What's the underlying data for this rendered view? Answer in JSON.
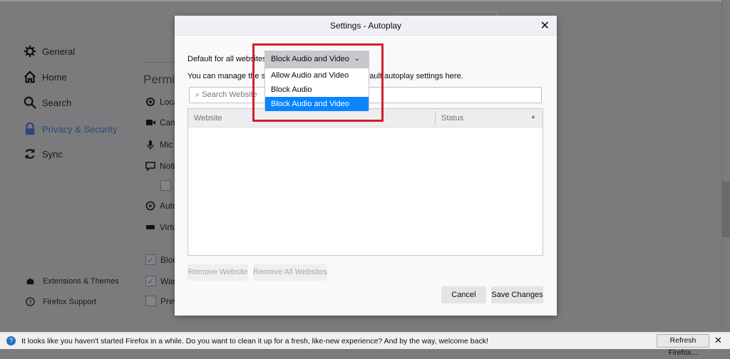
{
  "sidebar": {
    "items": [
      {
        "label": "General",
        "icon": "gear-icon"
      },
      {
        "label": "Home",
        "icon": "home-icon"
      },
      {
        "label": "Search",
        "icon": "search-icon"
      },
      {
        "label": "Privacy & Security",
        "icon": "lock-icon"
      },
      {
        "label": "Sync",
        "icon": "sync-icon"
      }
    ],
    "footer": [
      {
        "label": "Extensions & Themes",
        "icon": "puzzle-icon"
      },
      {
        "label": "Firefox Support",
        "icon": "help-icon"
      }
    ]
  },
  "background": {
    "section_title": "Permis",
    "items": [
      "Loca",
      "Cam",
      "Mic",
      "Noti",
      "Auto",
      "Virtu"
    ],
    "checks": [
      "Bloc",
      "War",
      "Prev"
    ]
  },
  "dialog": {
    "title": "Settings - Autoplay",
    "default_label": "Default for all websites:",
    "selected": "Block Audio and Video",
    "options": [
      "Allow Audio and Video",
      "Block Audio",
      "Block Audio and Video"
    ],
    "manage_text": "You can manage the sites that do not follow your default autoplay settings here.",
    "search_placeholder": "Search Website",
    "columns": [
      "Website",
      "Status"
    ],
    "remove_website": "Remove Website",
    "remove_all": "Remove All Websites",
    "cancel": "Cancel",
    "save": "Save Changes"
  },
  "notification": {
    "text": "It looks like you haven't started Firefox in a while. Do you want to clean it up for a fresh, like-new experience? And by the way, welcome back!",
    "button": "Refresh Firefox..."
  },
  "colors": {
    "accent": "#0a84ff",
    "highlight": "#d0202c"
  }
}
